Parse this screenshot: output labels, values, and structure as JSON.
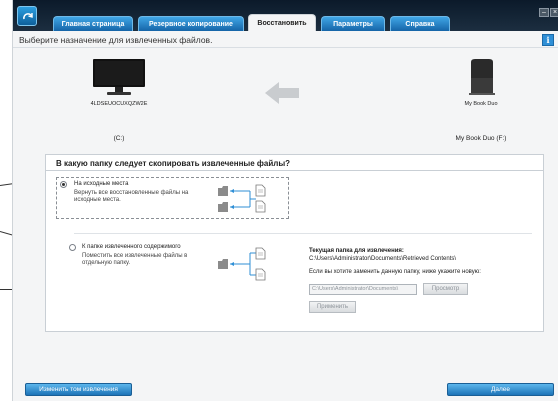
{
  "tabs": [
    {
      "label": "Главная страница"
    },
    {
      "label": "Резервное копирование"
    },
    {
      "label": "Восстановить"
    },
    {
      "label": "Параметры"
    },
    {
      "label": "Справка"
    }
  ],
  "active_tab": "Восстановить",
  "instruction": "Выберите назначение для извлеченных файлов.",
  "source": {
    "name": "4LDSEUOCUXQZW2E",
    "drive": "(C:)"
  },
  "target": {
    "name": "My Book Duo",
    "drive": "My Book Duo (F:)"
  },
  "panel": {
    "title": "В какую папку следует скопировать извлеченные файлы?",
    "option_original": {
      "title": "На исходные места",
      "description": "Вернуть все восстановленные файлы на исходные места.",
      "selected": true
    },
    "option_retrieved": {
      "title": "К папке извлеченного содержимого",
      "description": "Поместить все извлеченные файлы в отдельную папку.",
      "selected": false
    },
    "current_folder_label": "Текущая папка для извлечения:",
    "current_folder_path": "C:\\Users\\Administrator\\Documents\\Retrieved Contents\\",
    "change_hint": "Если вы хотите заменить данную папку, ниже укажите новую:",
    "folder_input_value": "C:\\Users\\Administrator\\Documents\\",
    "browse_label": "Просмотр",
    "apply_label": "Применить"
  },
  "buttons": {
    "change_volume": "Изменить том извлечения",
    "next": "Далее"
  },
  "colors": {
    "tab_bar": "#0b1a2a",
    "tab": "#2b8ad0",
    "button": "#2a86cc",
    "arrow": "#c9cccf"
  }
}
